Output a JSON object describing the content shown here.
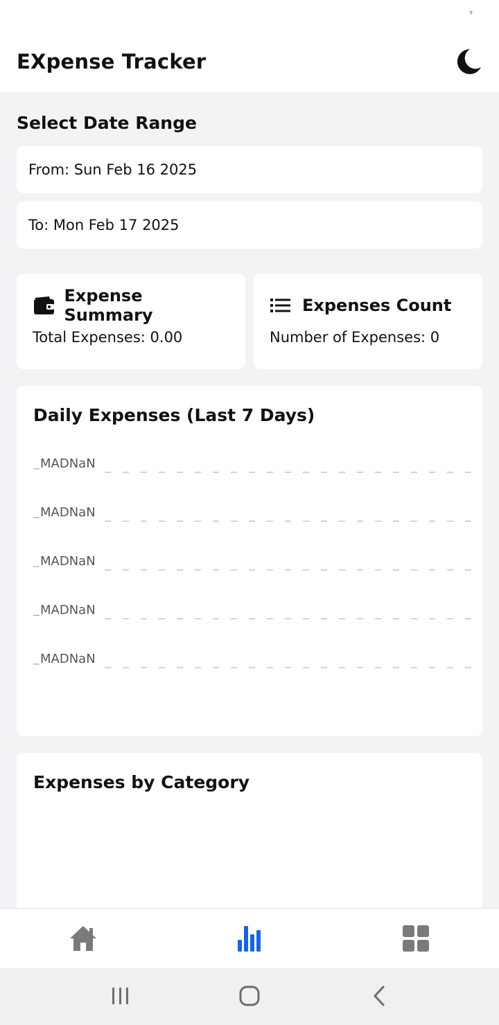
{
  "status_bar": {
    "indicator": "ᵀ"
  },
  "header": {
    "title": "EXpense Tracker",
    "theme_icon": "moon-icon"
  },
  "date_range": {
    "section_title": "Select Date Range",
    "from_label": "From: Sun Feb 16 2025",
    "to_label": "To: Mon Feb 17 2025"
  },
  "summary": {
    "title": "Expense Summary",
    "icon": "wallet-icon",
    "text": "Total Expenses: 0.00"
  },
  "count": {
    "title": "Expenses Count",
    "icon": "list-icon",
    "text": "Number of Expenses: 0"
  },
  "daily_chart": {
    "title": "Daily Expenses (Last 7 Days)"
  },
  "chart_data": {
    "type": "line",
    "title": "Daily Expenses (Last 7 Days)",
    "y_tick_labels": [
      "MADNaN",
      "MADNaN",
      "MADNaN",
      "MADNaN",
      "MADNaN"
    ],
    "x": [],
    "series": [],
    "grid": true,
    "grid_style": "dashed"
  },
  "category_chart": {
    "title": "Expenses by Category"
  },
  "bottom_nav": [
    {
      "name": "home",
      "icon": "home-icon",
      "active": false
    },
    {
      "name": "stats",
      "icon": "bar-chart-icon",
      "active": true
    },
    {
      "name": "grid",
      "icon": "grid-icon",
      "active": false
    }
  ],
  "colors": {
    "accent": "#1565e8",
    "inactive": "#7a7a7a",
    "background": "#f2f3f5"
  }
}
